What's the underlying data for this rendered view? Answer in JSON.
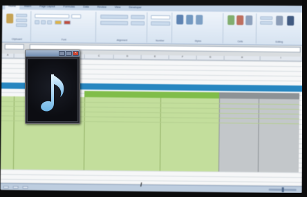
{
  "ribbon": {
    "tabs": [
      "Home",
      "Insert",
      "Page Layout",
      "Formulas",
      "Data",
      "Review",
      "View",
      "Developer"
    ],
    "groups": [
      "Clipboard",
      "Font",
      "Alignment",
      "Number",
      "Styles",
      "Cells",
      "Editing"
    ]
  },
  "formula_bar": {
    "name_box": "",
    "formula": ""
  },
  "column_headers": [
    "A",
    "B",
    "C",
    "D",
    "E",
    "F",
    "G",
    "H",
    "I"
  ],
  "spreadsheet": {
    "green_header": "",
    "grey_header": "",
    "green_cells": [
      "",
      "",
      "",
      ""
    ],
    "grey_cells": [
      "",
      ""
    ]
  },
  "media_player": {
    "title": "",
    "label": "",
    "icon": "music-note-icon"
  },
  "status_bar": {
    "sheet_tabs": [
      "",
      "",
      ""
    ]
  },
  "colors": {
    "blue_bar": "#1e88c8",
    "green_header": "#7cbf3f",
    "green_column": "#c1df96",
    "grey_block": "#c3c7ca",
    "player_bg": "#2a2c33"
  }
}
